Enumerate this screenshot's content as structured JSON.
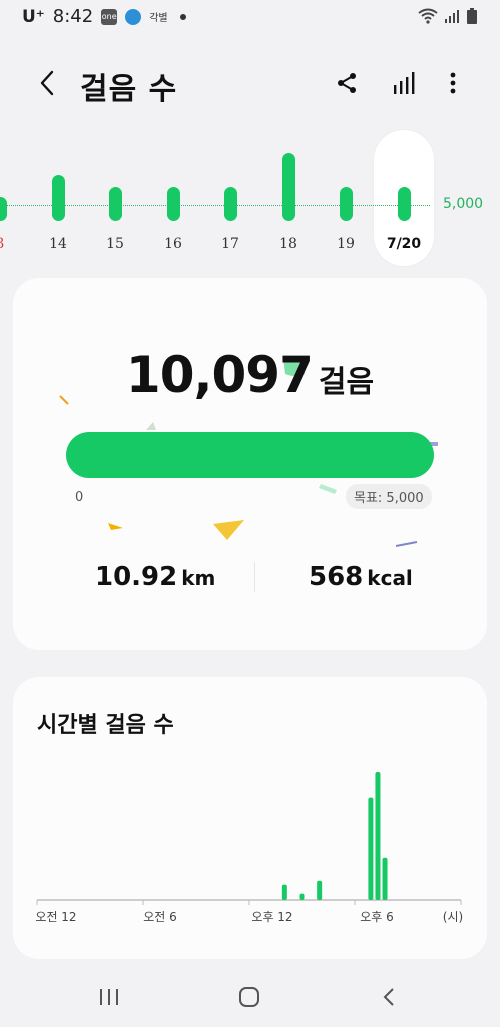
{
  "status_bar": {
    "carrier": "U⁺",
    "time": "8:42",
    "app_badge": "one",
    "small_text": "각별"
  },
  "header": {
    "title": "걸음 수"
  },
  "week": {
    "goal_label": "5,000",
    "days": [
      {
        "label": "3",
        "value": 0.24,
        "red": true
      },
      {
        "label": "14",
        "value": 0.46,
        "red": false
      },
      {
        "label": "15",
        "value": 0.34,
        "red": false
      },
      {
        "label": "16",
        "value": 0.34,
        "red": false
      },
      {
        "label": "17",
        "value": 0.34,
        "red": false
      },
      {
        "label": "18",
        "value": 0.68,
        "red": false
      },
      {
        "label": "19",
        "value": 0.34,
        "red": false
      },
      {
        "label": "7/20",
        "value": 0.34,
        "red": false,
        "today": true
      }
    ]
  },
  "summary": {
    "steps": "10,097",
    "steps_unit": "걸음",
    "progress_percent": 100,
    "progress_min": "0",
    "goal_label": "목표: 5,000",
    "distance_value": "10.92",
    "distance_unit": "km",
    "calories_value": "568",
    "calories_unit": "kcal"
  },
  "hourly": {
    "title": "시간별 걸음 수",
    "x_labels": [
      "오전 12",
      "오전 6",
      "오후 12",
      "오후 6",
      "(시)"
    ],
    "bars": [
      {
        "hour": 14.0,
        "value": 0.12
      },
      {
        "hour": 15.0,
        "value": 0.05
      },
      {
        "hour": 16.0,
        "value": 0.15
      },
      {
        "hour": 18.9,
        "value": 0.8
      },
      {
        "hour": 19.3,
        "value": 1.0
      },
      {
        "hour": 19.7,
        "value": 0.33
      }
    ],
    "accent": "#16c964"
  },
  "colors": {
    "accent": "#16c964",
    "background": "#f2f2f4",
    "card": "#fcfcfd"
  }
}
